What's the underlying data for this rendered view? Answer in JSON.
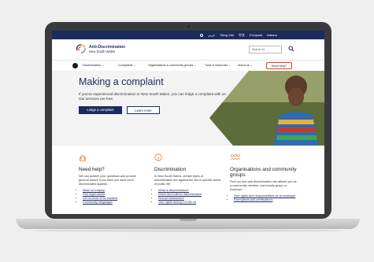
{
  "langbar": {
    "items": [
      "عربي",
      "Tiếng Việt",
      "中文",
      "Ελληνικά",
      "Italiano"
    ]
  },
  "header": {
    "logo_line1": "Anti-Discrimination",
    "logo_line2": "New South Wales",
    "search_placeholder": "Search for"
  },
  "nav": {
    "items": [
      "Discrimination ⌄",
      "Complaints ⌄",
      "Organisations & community groups ⌄",
      "Tools & resources ⌄",
      "About us ⌄"
    ],
    "cta": "Need help?"
  },
  "hero": {
    "title": "Making a complaint",
    "lead": "If you've experienced discrimination in New South Wales, you can lodge a complaint with us. Our services are free.",
    "primary_button": "Lodge a complaint",
    "secondary_button": "Learn more"
  },
  "columns": [
    {
      "title": "Need help?",
      "text": "We can answer your questions and provide general advice if you think you have been discriminated against.",
      "links": [
        "Make an enquiry",
        "Find legal advice",
        "Let us know of an incident",
        "Community languages"
      ]
    },
    {
      "title": "Discrimination",
      "text": "In New South Wales, certain types of discrimination are against the law in specific areas of public life.",
      "links": [
        "What is discrimination?",
        "Direct and indirect discrimination",
        "Sexual harassment",
        "Your rights during COVID-19"
      ]
    },
    {
      "title": "Organisations and community groups",
      "text": "Find out how anti-discrimination law affects you as a community member, community group or employer.",
      "links": [
        "Your rights and responsibilities as an employer",
        "Exemptions and certifications"
      ]
    }
  ],
  "colors": {
    "navy": "#1b2b5e",
    "accent": "#e23a2c",
    "icon_orange": "#e07a2b"
  }
}
